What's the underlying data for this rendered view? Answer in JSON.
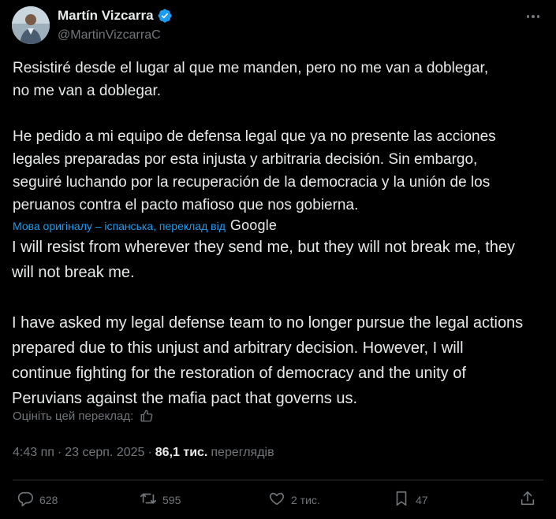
{
  "author": {
    "display_name": "Martín Vizcarra",
    "handle": "@MartinVizcarraC"
  },
  "original_text": {
    "paragraph1": "Resistiré desde el lugar al que me manden, pero no me van a doblegar,\nno me van a doblegar.",
    "paragraph2": "He pedido a mi equipo de defensa legal que ya no presente las acciones\nlegales preparadas por esta injusta y arbitraria decisión. Sin embargo,\nseguiré luchando por la recuperación de la democracia y la unión de los\nperuanos contra el pacto mafioso que nos gobierna."
  },
  "translation_note": {
    "label": "Мова оригіналу – іспанська, переклад від",
    "provider": "Google"
  },
  "translated_text": {
    "paragraph1": "I will resist from wherever they send me, but they will not break me, they\nwill not break me.",
    "paragraph2": "I have asked my legal defense team to no longer pursue the legal actions\nprepared due to this unjust and arbitrary decision. However, I will\ncontinue fighting for the restoration of democracy and the unity of\nPeruvians against the mafia pact that governs us."
  },
  "rate_translation": {
    "label": "Оцініть цей переклад:"
  },
  "meta": {
    "time": "4:43 пп",
    "separator": "·",
    "date": "23 серп. 2025",
    "views_count": "86,1 тис.",
    "views_label": "переглядів"
  },
  "actions": {
    "replies": "628",
    "reposts": "595",
    "likes": "2 тис.",
    "bookmarks": "47"
  },
  "icons": {
    "verified": "verified-badge-icon",
    "more": "more-icon",
    "thumbs_up": "thumbs-up-icon",
    "reply": "reply-icon",
    "repost": "repost-icon",
    "like": "heart-icon",
    "bookmark": "bookmark-icon",
    "share": "share-icon"
  },
  "colors": {
    "background": "#000000",
    "text": "#e7e9ea",
    "secondary": "#71767b",
    "link": "#1d9bf0",
    "verified": "#1d9bf0",
    "divider": "#2f3336"
  }
}
